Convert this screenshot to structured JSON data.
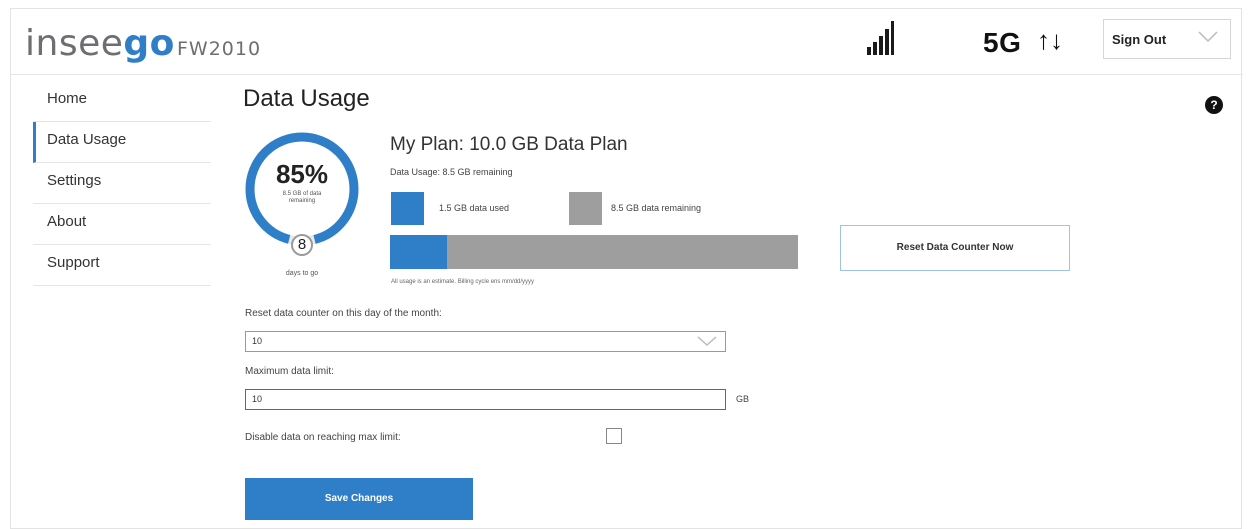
{
  "header": {
    "brand_prefix": "insee",
    "brand_suffix": "go",
    "model": "FW2010",
    "network": "5G",
    "transfer_arrows": "↑↓",
    "sign_out_label": "Sign Out"
  },
  "sidebar": {
    "items": [
      {
        "label": "Home"
      },
      {
        "label": "Data Usage"
      },
      {
        "label": "Settings"
      },
      {
        "label": "About"
      },
      {
        "label": "Support"
      }
    ],
    "active": "Data Usage"
  },
  "main": {
    "title": "Data Usage",
    "help_label": "?",
    "gauge": {
      "percent_label": "85%",
      "percent_value": 0.85,
      "subtext": "8.5 GB of data remaining",
      "days": "8",
      "days_label": "days to go"
    },
    "plan_title": "My Plan: 10.0 GB Data Plan",
    "usage_line": "Data Usage: 8.5 GB remaining",
    "legend": {
      "used": "1.5 GB data used",
      "remaining": "8.5 GB data remaining"
    },
    "bar": {
      "used_fraction": 0.14
    },
    "estimate_note": "All usage is an estimate. Billing cycle ens mm/dd/yyyy",
    "reset_button": "Reset Data Counter Now",
    "reset_day_label": "Reset data counter on this day of the month:",
    "reset_day_value": "10",
    "max_limit_label": "Maximum data limit:",
    "max_limit_value": "10",
    "max_limit_unit": "GB",
    "disable_label": "Disable data on reaching max limit:",
    "save_button": "Save Changes"
  },
  "colors": {
    "accent": "#2f7fc8",
    "remaining": "#9e9e9e"
  }
}
